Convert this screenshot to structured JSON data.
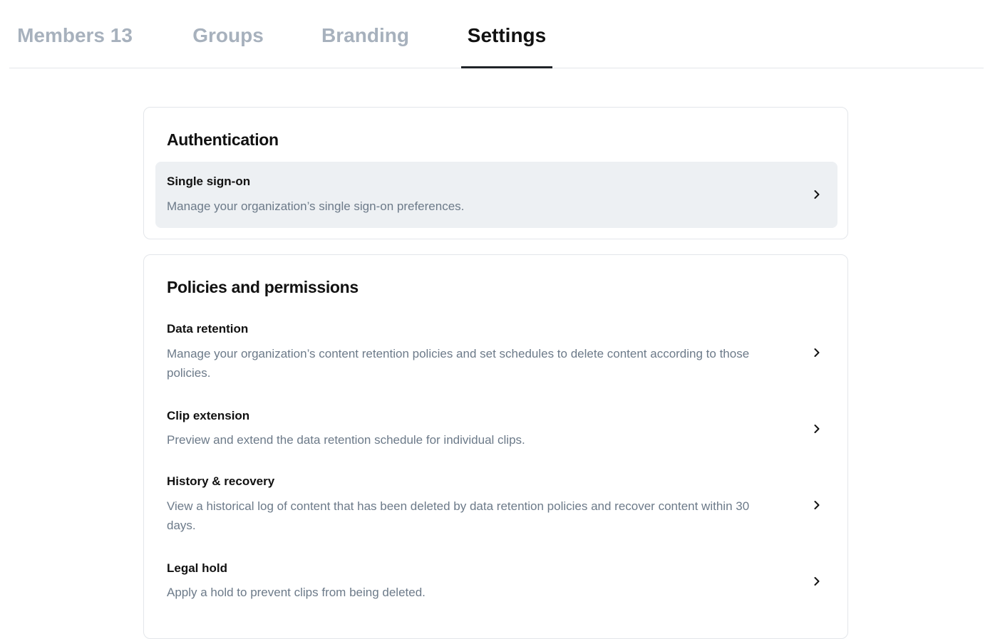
{
  "tabs": {
    "members": "Members 13",
    "groups": "Groups",
    "branding": "Branding",
    "settings": "Settings",
    "active": "settings"
  },
  "authentication": {
    "title": "Authentication",
    "items": [
      {
        "title": "Single sign-on",
        "description": "Manage your organization’s single sign-on preferences.",
        "icon": "chevron-right-icon"
      }
    ]
  },
  "policies": {
    "title": "Policies and permissions",
    "items": [
      {
        "title": "Data retention",
        "description": "Manage your organization’s content retention policies and set schedules to delete content according to those policies.",
        "icon": "chevron-right-icon"
      },
      {
        "title": "Clip extension",
        "description": "Preview and extend the data retention schedule for individual clips.",
        "icon": "chevron-right-icon"
      },
      {
        "title": "History & recovery",
        "description": "View a historical log of content that has been deleted by data retention policies and recover content within 30 days.",
        "icon": "chevron-right-icon"
      },
      {
        "title": "Legal hold",
        "description": "Apply a hold to prevent clips from being deleted.",
        "icon": "chevron-right-icon"
      }
    ]
  },
  "colors": {
    "active_tab_underline": "#1f2328",
    "inactive_tab_text": "#a7b1bd",
    "row_highlight": "#edf0f3",
    "description_text": "#6c7a89"
  }
}
